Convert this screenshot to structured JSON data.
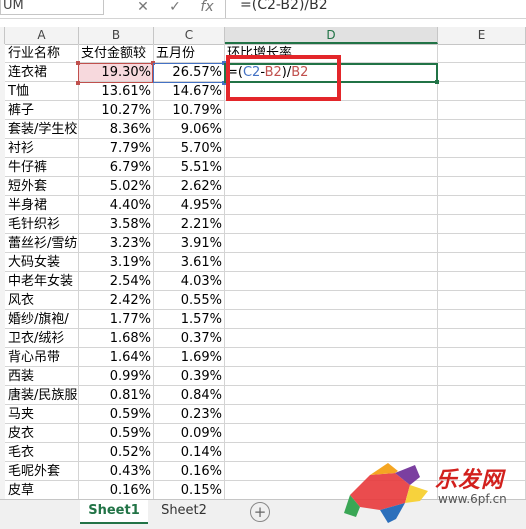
{
  "formula_bar": {
    "name_box": "UM",
    "cancel": "✕",
    "enter": "✓",
    "fx": "fx",
    "formula": "=(C2-B2)/B2"
  },
  "columns": [
    "A",
    "B",
    "C",
    "D",
    "E"
  ],
  "header_row": {
    "a": "行业名称",
    "b": "支付金额较",
    "c": "五月份",
    "d": "环比增长率"
  },
  "active_formula": {
    "eq": "=(",
    "c": "C2",
    "minus": "-",
    "b": "B2",
    "close": ")/",
    "b2": "B2"
  },
  "rows": [
    {
      "a": "连衣裙",
      "b": "19.30%",
      "c": "26.57%"
    },
    {
      "a": "T恤",
      "b": "13.61%",
      "c": "14.67%"
    },
    {
      "a": "裤子",
      "b": "10.27%",
      "c": "10.79%"
    },
    {
      "a": "套装/学生校",
      "b": "8.36%",
      "c": "9.06%"
    },
    {
      "a": "衬衫",
      "b": "7.79%",
      "c": "5.70%"
    },
    {
      "a": "牛仔裤",
      "b": "6.79%",
      "c": "5.51%"
    },
    {
      "a": "短外套",
      "b": "5.02%",
      "c": "2.62%"
    },
    {
      "a": "半身裙",
      "b": "4.40%",
      "c": "4.95%"
    },
    {
      "a": "毛针织衫",
      "b": "3.58%",
      "c": "2.21%"
    },
    {
      "a": "蕾丝衫/雪纺",
      "b": "3.23%",
      "c": "3.91%"
    },
    {
      "a": "大码女装",
      "b": "3.19%",
      "c": "3.61%"
    },
    {
      "a": "中老年女装",
      "b": "2.54%",
      "c": "4.03%"
    },
    {
      "a": "风衣",
      "b": "2.42%",
      "c": "0.55%"
    },
    {
      "a": "婚纱/旗袍/",
      "b": "1.77%",
      "c": "1.57%"
    },
    {
      "a": "卫衣/绒衫",
      "b": "1.68%",
      "c": "0.37%"
    },
    {
      "a": "背心吊带",
      "b": "1.64%",
      "c": "1.69%"
    },
    {
      "a": "西装",
      "b": "0.99%",
      "c": "0.39%"
    },
    {
      "a": "唐装/民族服",
      "b": "0.81%",
      "c": "0.84%"
    },
    {
      "a": "马夹",
      "b": "0.59%",
      "c": "0.23%"
    },
    {
      "a": "皮衣",
      "b": "0.59%",
      "c": "0.09%"
    },
    {
      "a": "毛衣",
      "b": "0.52%",
      "c": "0.14%"
    },
    {
      "a": "毛呢外套",
      "b": "0.43%",
      "c": "0.16%"
    },
    {
      "a": "皮草",
      "b": "0.16%",
      "c": "0.15%"
    }
  ],
  "sheets": [
    "Sheet1",
    "Sheet2"
  ],
  "add_sheet": "+",
  "watermark": {
    "brand": "乐发网",
    "url": "www.6pf.cn"
  }
}
